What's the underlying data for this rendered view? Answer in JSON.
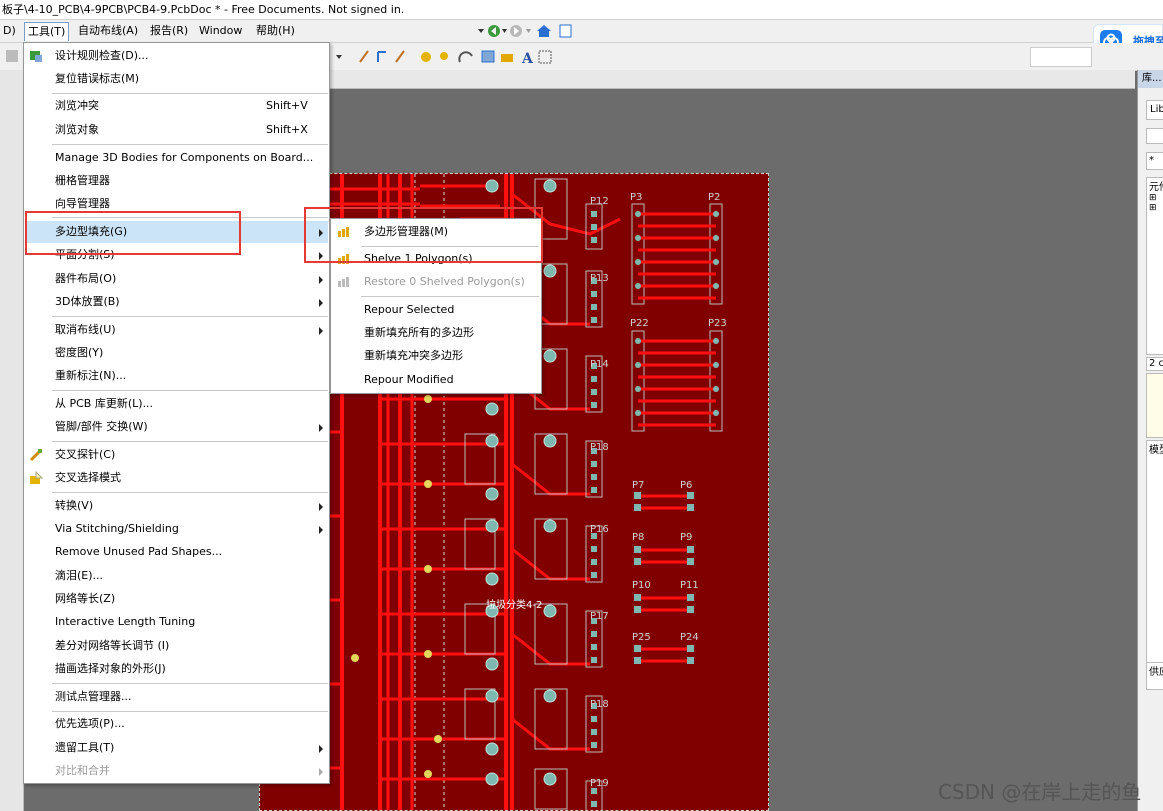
{
  "window": {
    "title_prefix": "板子\\4-10_PCB\\4-9PCB\\PCB4-9.PcbDoc * - Free Documents. Not signed in."
  },
  "menubar": {
    "items": [
      {
        "label": "D)"
      },
      {
        "label": "工具(T)"
      },
      {
        "label": "自动布线(A)"
      },
      {
        "label": "报告(R)"
      },
      {
        "label": "Window"
      },
      {
        "label": "帮助(H)"
      }
    ]
  },
  "baidu": {
    "label": "拖拽至"
  },
  "tools_menu": {
    "items": [
      {
        "label": "设计规则检查(D)..."
      },
      {
        "label": "复位错误标志(M)"
      },
      {
        "label": "浏览冲突",
        "shortcut": "Shift+V"
      },
      {
        "label": "浏览对象",
        "shortcut": "Shift+X"
      },
      {
        "label": "Manage 3D Bodies for Components on Board..."
      },
      {
        "label": "栅格管理器"
      },
      {
        "label": "向导管理器"
      },
      {
        "label": "多边型填充(G)"
      },
      {
        "label": "平面分割(S)"
      },
      {
        "label": "器件布局(O)"
      },
      {
        "label": "3D体放置(B)"
      },
      {
        "label": "取消布线(U)"
      },
      {
        "label": "密度图(Y)"
      },
      {
        "label": "重新标注(N)..."
      },
      {
        "label": "从 PCB 库更新(L)..."
      },
      {
        "label": "管脚/部件 交换(W)"
      },
      {
        "label": "交叉探针(C)"
      },
      {
        "label": "交叉选择模式"
      },
      {
        "label": "转换(V)"
      },
      {
        "label": "Via Stitching/Shielding"
      },
      {
        "label": "Remove Unused Pad Shapes..."
      },
      {
        "label": "滴泪(E)..."
      },
      {
        "label": "网络等长(Z)"
      },
      {
        "label": "Interactive Length Tuning"
      },
      {
        "label": "差分对网络等长调节 (I)"
      },
      {
        "label": "描画选择对象的外形(J)"
      },
      {
        "label": "测试点管理器..."
      },
      {
        "label": "优先选项(P)..."
      },
      {
        "label": "遗留工具(T)"
      },
      {
        "label": "对比和合并"
      }
    ]
  },
  "polygon_submenu": {
    "items": [
      {
        "label": "多边形管理器(M)"
      },
      {
        "label": "Shelve 1 Polygon(s)"
      },
      {
        "label": "Restore 0 Shelved Polygon(s)"
      },
      {
        "label": "Repour Selected"
      },
      {
        "label": "重新填充所有的多边形"
      },
      {
        "label": "重新填充冲突多边形"
      },
      {
        "label": "Repour Modified"
      }
    ]
  },
  "pcb": {
    "designators": [
      "P12",
      "P3",
      "P2",
      "P13",
      "P22",
      "P23",
      "P14",
      "P18",
      "P7",
      "P6",
      "P16",
      "P8",
      "P9",
      "P10",
      "P11",
      "P17",
      "P25",
      "P24",
      "P19"
    ],
    "room_label": "垃圾分类4-2"
  },
  "right_panel": {
    "header": "库...",
    "tab": "Lib",
    "section1": "元件",
    "count": "2 c",
    "section2": "模型",
    "section3": "供应"
  },
  "watermark": "CSDN @在岸上走的鱼",
  "colors": {
    "board": "#800000",
    "trace": "#ff0000",
    "highlight": "#e53935",
    "menu_hover": "#cce4f7"
  }
}
